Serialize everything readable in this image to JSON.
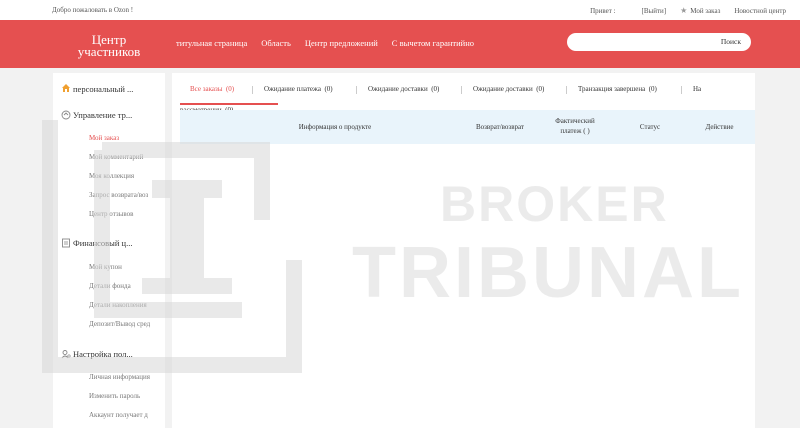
{
  "topbar": {
    "welcome": "Добро пожаловать в Ozon  !",
    "greeting": "Привет :",
    "logout": "[Выйти]",
    "my_order": "Мой заказ",
    "news": "Новостной центр"
  },
  "header": {
    "logo_line1": "Центр",
    "logo_line2": "участников",
    "nav": [
      "титульная страница",
      "Область",
      "Центр предложений",
      "С вычетом гарантийно"
    ],
    "search_placeholder": "",
    "search_button": "Поиск"
  },
  "sidebar": {
    "sections": [
      {
        "title": "персональный ...",
        "icon": "home-icon",
        "items": []
      },
      {
        "title": "Управление тр...",
        "icon": "order-management-icon",
        "items": [
          "Мой заказ",
          "Мой комментарий",
          "Моя коллекция",
          "Запрос возврата/воз",
          "Центр отзывов"
        ]
      },
      {
        "title": "Финансовый ц...",
        "icon": "finance-icon",
        "items": [
          "Мой купон",
          "Детали фонда",
          "Детали накопления",
          "Депозит/Вывод сред"
        ]
      },
      {
        "title": "Настройка пол...",
        "icon": "user-settings-icon",
        "items": [
          "Личная информация",
          "Изменить пароль",
          "Аккаунт получает д"
        ]
      }
    ],
    "active_item": "Мой заказ"
  },
  "watermark": {
    "line1": "BROKER",
    "line2": "TRIBUNAL"
  },
  "main": {
    "tabs": [
      {
        "label": "Все заказы",
        "count": "(0)"
      },
      {
        "label": "Ожидание платежа",
        "count": "(0)"
      },
      {
        "label": "Ожидание доставки",
        "count": "(0)"
      },
      {
        "label": "Ожидание доставки",
        "count": "(0)"
      },
      {
        "label": "Транзакция завершена",
        "count": "(0)"
      },
      {
        "label": "На",
        "count": ""
      }
    ],
    "tab_wrap": {
      "label": "рассмотрении",
      "count": "(0)"
    },
    "columns": [
      "Информация о продукте",
      "Возврат/возврат",
      "Фактический платеж ( )",
      "Статус",
      "Действие"
    ]
  },
  "colors": {
    "accent": "#e55050",
    "header_bg": "#e55050",
    "table_header_bg": "#e9f4fb"
  }
}
